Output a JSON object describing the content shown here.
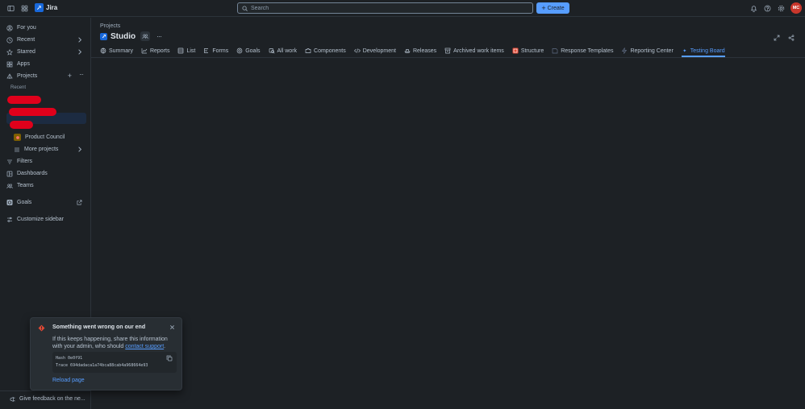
{
  "topbar": {
    "app_name": "Jira",
    "search_placeholder": "Search",
    "create_label": "Create",
    "avatar_initials": "MC"
  },
  "sidebar": {
    "items": [
      {
        "label": "For you",
        "icon": "person-circle-icon"
      },
      {
        "label": "Recent",
        "icon": "clock-icon"
      },
      {
        "label": "Starred",
        "icon": "star-icon"
      },
      {
        "label": "Apps",
        "icon": "apps-icon"
      },
      {
        "label": "Projects",
        "icon": "projects-icon"
      }
    ],
    "recent_section": "Recent",
    "project_items": [
      {
        "label": "Product Council"
      },
      {
        "label": "More projects"
      }
    ],
    "bottom_items": [
      {
        "label": "Filters"
      },
      {
        "label": "Dashboards"
      },
      {
        "label": "Teams"
      },
      {
        "label": "Goals"
      },
      {
        "label": "Customize sidebar"
      }
    ],
    "feedback": "Give feedback on the ne..."
  },
  "main": {
    "breadcrumb": "Projects",
    "project_title": "Studio",
    "tabs": [
      {
        "label": "Summary"
      },
      {
        "label": "Reports"
      },
      {
        "label": "List"
      },
      {
        "label": "Forms"
      },
      {
        "label": "Goals"
      },
      {
        "label": "All work"
      },
      {
        "label": "Components"
      },
      {
        "label": "Development"
      },
      {
        "label": "Releases"
      },
      {
        "label": "Archived work items"
      },
      {
        "label": "Structure"
      },
      {
        "label": "Response Templates"
      },
      {
        "label": "Reporting Center"
      },
      {
        "label": "Testing Board"
      }
    ],
    "active_tab": "Testing Board"
  },
  "error_flag": {
    "title": "Something went wrong on our end",
    "message": "If this keeps happening, share this information with your admin, who should",
    "link": "contact support",
    "period": ".",
    "hash_line": "Hash 0e0f91",
    "trace_line": "Trace 694dadaca1a74bca88cab4a968664e93",
    "reload_label": "Reload page"
  },
  "colors": {
    "background": "#1d2125",
    "accent": "#579dff",
    "error": "#e34935",
    "avatar": "#c9372c"
  }
}
